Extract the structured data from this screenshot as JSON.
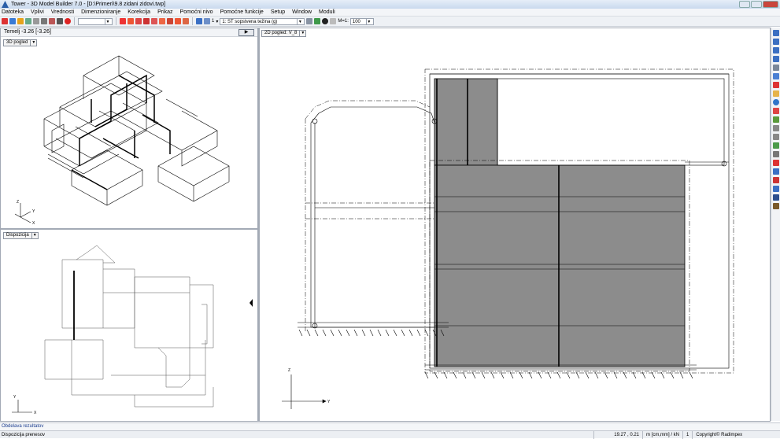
{
  "window": {
    "title": "Tower - 3D Model Builder 7.0 - [D:\\Primeri\\9.8 zidani zidovi.twp]"
  },
  "menu": [
    "Datoteka",
    "Vplivi",
    "Vrednosti",
    "Dimenzioniranje",
    "Korekcija",
    "Prikaz",
    "Pomoćni nivo",
    "Pomoćne funkcije",
    "Setup",
    "Window",
    "Moduli"
  ],
  "toolbar": {
    "load_case": "1: ST sopstvena težina (g)",
    "scale_label": "M=1:",
    "scale_value": "100",
    "level_label": "1"
  },
  "left_top": {
    "header": "Temelj -3.26   [-3.26]",
    "view": "3D pogled"
  },
  "left_bottom": {
    "view": "Dispozicija"
  },
  "right": {
    "view": "2D pogled: V_8"
  },
  "axis_labels": {
    "z": "Z",
    "y": "Y",
    "x": "X",
    "z2": "Z",
    "y2": "Y"
  },
  "tab": "Obdelava rezultatov",
  "status": {
    "left": "Dispozicija prenesov",
    "coords": "19.27 , 0.21",
    "units": "m [cm,mm] / kN",
    "page": "1",
    "copyright": "Copyright© Radimpex"
  },
  "colors": {
    "fill_gray": "#8c8c8c",
    "accent": "#2a5ea8"
  }
}
